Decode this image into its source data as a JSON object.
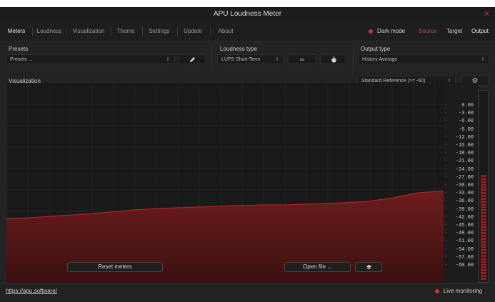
{
  "window": {
    "title": "APU Loudness Meter",
    "close_icon": "close-icon"
  },
  "nav": {
    "tabs": [
      "Meters",
      "Loudness",
      "Visualization",
      "Theme",
      "Settings",
      "Update",
      "About"
    ],
    "active_tab": "Meters",
    "dark_mode_label": "Dark mode",
    "source_label": "Source",
    "target_label": "Target",
    "output_label": "Output"
  },
  "presets": {
    "label": "Presets",
    "value": "Presets ...",
    "edit_icon": "pencil-icon"
  },
  "loudness_type": {
    "label": "Loudness type",
    "value": "LUFS Short-Term",
    "infinity_icon": "infinity-icon",
    "timer_icon": "stopwatch-icon"
  },
  "output_type": {
    "label": "Output type",
    "value": "History Average"
  },
  "visualization": {
    "label": "Visualization",
    "reference_value": "Standard Reference (>= -60)",
    "settings_icon": "gear-icon"
  },
  "scale": {
    "ticks": [
      "0.00",
      "-3.00",
      "-6.00",
      "-9.00",
      "-12.00",
      "-15.00",
      "-18.00",
      "-21.00",
      "-24.00",
      "-27.00",
      "-30.00",
      "-33.00",
      "-36.00",
      "-39.00",
      "-42.00",
      "-45.00",
      "-48.00",
      "-51.00",
      "-54.00",
      "-57.00",
      "-60.00"
    ]
  },
  "history": {
    "y_range": [
      -60,
      0
    ],
    "values": [
      -42.2,
      -41.7,
      -41.1,
      -40.5,
      -39.7,
      -38.8,
      -38.3,
      -37.9,
      -37.6,
      -37.2,
      -37.0,
      -36.9,
      -36.6,
      -36.2,
      -35.7,
      -34.4,
      -32.4,
      -31.8
    ]
  },
  "meter": {
    "level_fraction": 0.56,
    "color": "#8b2020"
  },
  "plot_buttons": {
    "reset": "Reset meters",
    "open_file": "Open file ...",
    "layers_icon": "layers-icon"
  },
  "footer": {
    "link": "https://apu.software/",
    "live_label": "Live monitoring"
  },
  "colors": {
    "accent": "#c0393b",
    "area_fill": "#5a1818",
    "area_line": "#a8262a"
  }
}
